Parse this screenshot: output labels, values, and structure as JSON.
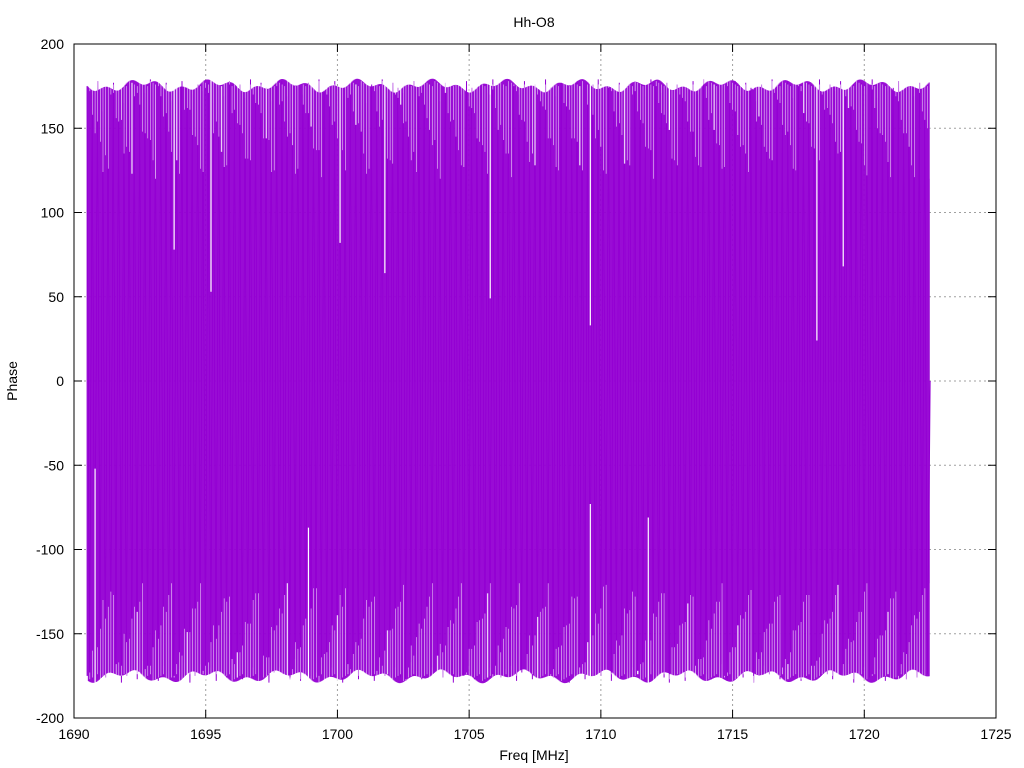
{
  "chart_data": {
    "type": "line",
    "title": "Hh-O8",
    "xlabel": "Freq [MHz]",
    "ylabel": "Phase",
    "xlim": [
      1690,
      1725
    ],
    "ylim": [
      -200,
      200
    ],
    "xticks": [
      1690,
      1695,
      1700,
      1705,
      1710,
      1715,
      1720,
      1725
    ],
    "yticks": [
      -200,
      -150,
      -100,
      -50,
      0,
      50,
      100,
      150,
      200
    ],
    "grid": true,
    "legend": "none",
    "series": [
      {
        "color": "#9400d3",
        "x_range": [
          1690.5,
          1722.5
        ],
        "approx_y_range": [
          -180,
          180
        ],
        "note_pattern": "dense wrapped phase oscillation",
        "x": [
          1690.5,
          1690.6,
          1690.7,
          1690.8,
          1690.9,
          1691.0,
          1691.1,
          1691.2,
          1691.3,
          1691.4,
          1691.5,
          1691.6,
          1691.7,
          1691.8,
          1691.9,
          1692.0,
          1692.1,
          1692.2,
          1692.3,
          1692.4,
          1692.5,
          1692.6,
          1692.7,
          1692.8,
          1692.9,
          1693.0,
          1693.1,
          1693.2,
          1693.3,
          1693.4,
          1693.5,
          1693.6,
          1693.7,
          1693.8,
          1693.9,
          1694.0,
          1694.1,
          1694.2,
          1694.3,
          1694.4,
          1694.5,
          1694.6,
          1694.7,
          1694.8,
          1694.9,
          1695.0,
          1695.1,
          1695.2,
          1695.3,
          1695.4,
          1695.5,
          1695.6,
          1695.7,
          1695.8,
          1695.9,
          1696.0,
          1696.1,
          1696.2,
          1696.3,
          1696.4,
          1696.5,
          1696.6,
          1696.7,
          1696.8,
          1696.9,
          1697.0,
          1697.1,
          1697.2,
          1697.3,
          1697.4,
          1697.5,
          1697.6,
          1697.7,
          1697.8,
          1697.9,
          1698.0,
          1698.1,
          1698.2,
          1698.3,
          1698.4,
          1698.5,
          1698.6,
          1698.7,
          1698.8,
          1698.9,
          1699.0,
          1699.1,
          1699.2,
          1699.3,
          1699.4,
          1699.5,
          1699.6,
          1699.7,
          1699.8,
          1699.9,
          1700.0,
          1700.1,
          1700.2,
          1700.3,
          1700.4,
          1700.5,
          1700.6,
          1700.7,
          1700.8,
          1700.9,
          1701.0,
          1701.1,
          1701.2,
          1701.3,
          1701.4,
          1701.5,
          1701.6,
          1701.7,
          1701.8,
          1701.9,
          1702.0,
          1702.1,
          1702.2,
          1702.3,
          1702.4,
          1702.5,
          1702.6,
          1702.7,
          1702.8,
          1702.9,
          1703.0,
          1703.1,
          1703.2,
          1703.3,
          1703.4,
          1703.5,
          1703.6,
          1703.7,
          1703.8,
          1703.9,
          1704.0,
          1704.1,
          1704.2,
          1704.3,
          1704.4,
          1704.5,
          1704.6,
          1704.7,
          1704.8,
          1704.9,
          1705.0,
          1705.1,
          1705.2,
          1705.3,
          1705.4,
          1705.5,
          1705.6,
          1705.7,
          1705.8,
          1705.9,
          1706.0,
          1706.1,
          1706.2,
          1706.3,
          1706.4,
          1706.5,
          1706.6,
          1706.7,
          1706.8,
          1706.9,
          1707.0,
          1707.1,
          1707.2,
          1707.3,
          1707.4,
          1707.5,
          1707.6,
          1707.7,
          1707.8,
          1707.9,
          1708.0,
          1708.1,
          1708.2,
          1708.3,
          1708.4,
          1708.5,
          1708.6,
          1708.7,
          1708.8,
          1708.9,
          1709.0,
          1709.1,
          1709.2,
          1709.3,
          1709.4,
          1709.5,
          1709.6,
          1709.7,
          1709.8,
          1709.9,
          1710.0,
          1710.1,
          1710.2,
          1710.3,
          1710.4,
          1710.5,
          1710.6,
          1710.7,
          1710.8,
          1710.9,
          1711.0,
          1711.1,
          1711.2,
          1711.3,
          1711.4,
          1711.5,
          1711.6,
          1711.7,
          1711.8,
          1711.9,
          1712.0,
          1712.1,
          1712.2,
          1712.3,
          1712.4,
          1712.5,
          1712.6,
          1712.7,
          1712.8,
          1712.9,
          1713.0,
          1713.1,
          1713.2,
          1713.3,
          1713.4,
          1713.5,
          1713.6,
          1713.7,
          1713.8,
          1713.9,
          1714.0,
          1714.1,
          1714.2,
          1714.3,
          1714.4,
          1714.5,
          1714.6,
          1714.7,
          1714.8,
          1714.9,
          1715.0,
          1715.1,
          1715.2,
          1715.3,
          1715.4,
          1715.5,
          1715.6,
          1715.7,
          1715.8,
          1715.9,
          1716.0,
          1716.1,
          1716.2,
          1716.3,
          1716.4,
          1716.5,
          1716.6,
          1716.7,
          1716.8,
          1716.9,
          1717.0,
          1717.1,
          1717.2,
          1717.3,
          1717.4,
          1717.5,
          1717.6,
          1717.7,
          1717.8,
          1717.9,
          1718.0,
          1718.1,
          1718.2,
          1718.3,
          1718.4,
          1718.5,
          1718.6,
          1718.7,
          1718.8,
          1718.9,
          1719.0,
          1719.1,
          1719.2,
          1719.3,
          1719.4,
          1719.5,
          1719.6,
          1719.7,
          1719.8,
          1719.9,
          1720.0,
          1720.1,
          1720.2,
          1720.3,
          1720.4,
          1720.5,
          1720.6,
          1720.7,
          1720.8,
          1720.9,
          1721.0,
          1721.1,
          1721.2,
          1721.3,
          1721.4,
          1721.5,
          1721.6,
          1721.7,
          1721.8,
          1721.9,
          1722.0,
          1722.1,
          1722.2,
          1722.3,
          1722.4,
          1722.5
        ],
        "y": [
          175,
          -178,
          170,
          -165,
          178,
          -172,
          160,
          -176,
          174,
          -170,
          177,
          -168,
          172,
          -179,
          165,
          -175,
          178,
          -171,
          169,
          -177,
          176,
          -166,
          171,
          -174,
          179,
          -173,
          168,
          -178,
          175,
          -169,
          177,
          -172,
          166,
          -176,
          173,
          -171,
          178,
          -167,
          174,
          -179,
          170,
          -175,
          176,
          -168,
          172,
          -174,
          177,
          -170,
          165,
          -178,
          175,
          -172,
          169,
          -176,
          178,
          -165,
          173,
          -171,
          176,
          -177,
          168,
          -174,
          179,
          -170,
          171,
          -176,
          177,
          -168,
          174,
          -179,
          166,
          -173,
          175,
          -170,
          178,
          -172,
          169,
          -177,
          176,
          -165,
          174,
          -178,
          170,
          -171,
          177,
          -175,
          168,
          -173,
          179,
          -169,
          172,
          -176,
          175,
          -170,
          178,
          -174,
          167,
          -179,
          173,
          -168,
          176,
          -172,
          170,
          -177,
          178,
          -171,
          165,
          -174,
          176,
          -178,
          172,
          -169,
          179,
          -175,
          168,
          -173,
          177,
          -170,
          174,
          -176,
          171,
          -178,
          175,
          -167,
          178,
          -172,
          169,
          -177,
          176,
          -174,
          173,
          -170,
          179,
          -168,
          166,
          -176,
          177,
          -171,
          172,
          -179,
          175,
          -173,
          170,
          -175,
          178,
          -169,
          174,
          -177,
          168,
          -172,
          176,
          -178,
          171,
          -170,
          179,
          -174,
          167,
          -176,
          173,
          -171,
          177,
          -169,
          175,
          -178,
          170,
          -173,
          178,
          -172,
          166,
          -177,
          176,
          -170,
          172,
          -175,
          179,
          -168,
          174,
          -176,
          169,
          -173,
          177,
          -171,
          175,
          -179,
          168,
          -174,
          178,
          -170,
          173,
          -177,
          170,
          -172,
          176,
          -168,
          179,
          -175,
          167,
          -171,
          174,
          -178,
          172,
          -169,
          177,
          -176,
          165,
          -173,
          176,
          -170,
          178,
          -172,
          173,
          -177,
          169,
          -174,
          179,
          -168,
          175,
          -171,
          171,
          -176,
          177,
          -179,
          168,
          -173,
          176,
          -170,
          174,
          -178,
          172,
          -172,
          178,
          -169,
          170,
          -175,
          179,
          -174,
          167,
          -177,
          173,
          -171,
          176,
          -168,
          175,
          -178,
          171,
          -173,
          178,
          -170,
          169,
          -176,
          177,
          -172,
          174,
          -179,
          166,
          -175,
          176,
          -169,
          172,
          -174,
          179,
          -171,
          173,
          -177,
          170,
          -170,
          178,
          -176,
          168,
          -173,
          175,
          -178,
          171,
          -172,
          177,
          -169,
          174,
          -176,
          179,
          -170,
          167,
          -174,
          176,
          -177,
          172,
          -171,
          178,
          -173,
          169,
          -168,
          175,
          -179,
          173,
          -172,
          177,
          -170,
          170,
          -176,
          179,
          -174,
          168,
          -171,
          176,
          -178,
          172,
          -169,
          174,
          -175,
          178,
          -173,
          171,
          -177,
          175,
          -170,
          169,
          -176,
          177,
          -172,
          173,
          -174,
          0
        ]
      }
    ]
  }
}
